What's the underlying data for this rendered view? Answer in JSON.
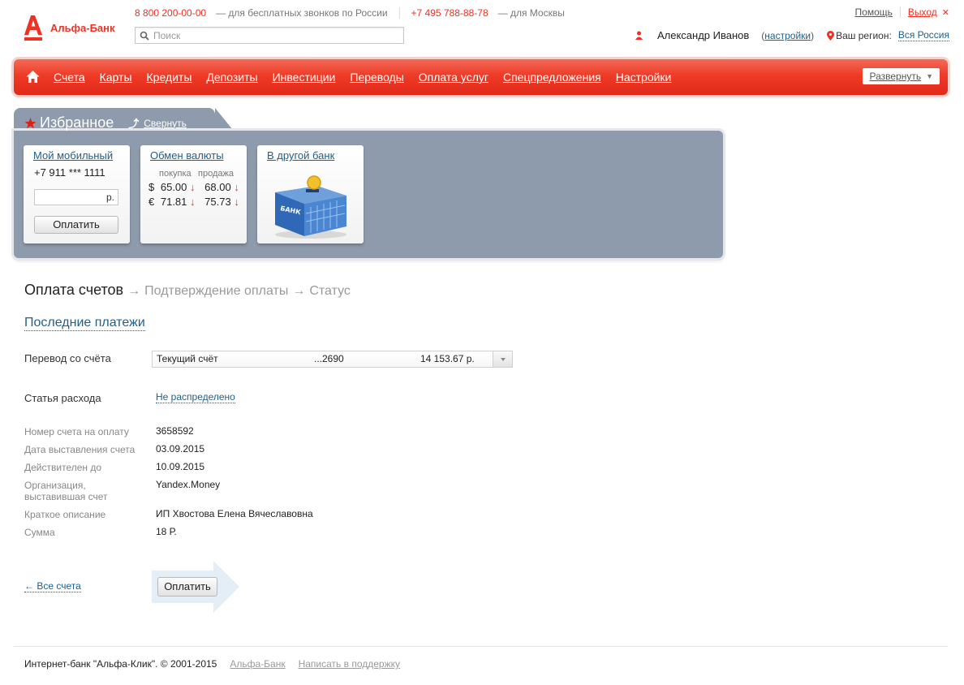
{
  "header": {
    "logo_text": "Альфа-Банк",
    "phone_free": "8 800 200-00-00",
    "phone_free_note": "— для бесплатных звонков по России",
    "phone_moscow": "+7 495 788-88-78",
    "phone_moscow_note": "— для Москвы",
    "search_placeholder": "Поиск",
    "help_label": "Помощь",
    "logout_label": "Выход",
    "user_name": "Александр Иванов",
    "settings_label": "настройки",
    "region_label": "Ваш регион:",
    "region_value": "Вся Россия"
  },
  "nav": {
    "items": [
      "Счета",
      "Карты",
      "Кредиты",
      "Депозиты",
      "Инвестиции",
      "Переводы",
      "Оплата услуг",
      "Спецпредложения",
      "Настройки"
    ],
    "expand_label": "Развернуть"
  },
  "favorites": {
    "title": "Избранное",
    "collapse_label": "Свернуть",
    "mobile": {
      "title": "Мой мобильный",
      "phone": "+7 911 *** 1111",
      "currency": "р.",
      "pay_label": "Оплатить"
    },
    "exchange": {
      "title": "Обмен валюты",
      "buy_label": "покупка",
      "sell_label": "продажа",
      "rows": [
        {
          "symbol": "$",
          "buy": "65.00",
          "sell": "68.00"
        },
        {
          "symbol": "€",
          "buy": "71.81",
          "sell": "75.73"
        }
      ],
      "trend_symbol": "↓"
    },
    "other_bank": {
      "title": "В другой банк",
      "building_sign": "БАНК"
    }
  },
  "steps": {
    "current": "Оплата счетов",
    "next": [
      "Подтверждение оплаты",
      "Статус"
    ],
    "arrow": "→"
  },
  "recent_payments": "Последние платежи",
  "transfer": {
    "label": "Перевод со счёта",
    "account_name": "Текущий счёт",
    "account_number": "...2690",
    "balance": "14 153.67 р."
  },
  "expense": {
    "label": "Статья расхода",
    "value": "Не распределено"
  },
  "details": [
    {
      "label": "Номер счета на оплату",
      "value": "3658592"
    },
    {
      "label": "Дата выставления счета",
      "value": "03.09.2015"
    },
    {
      "label": "Действителен до",
      "value": "10.09.2015"
    },
    {
      "label": "Организация,",
      "label2": "выставившая счет",
      "value": "Yandex.Money"
    },
    {
      "label": "Краткое описание",
      "value": "ИП Хвостова Елена Вячеславовна"
    },
    {
      "label": "Сумма",
      "value": "18 Р."
    }
  ],
  "actions": {
    "back_label": "← Все счета",
    "pay_label": "Оплатить"
  },
  "footer": {
    "copyright": "Интернет-банк \"Альфа-Клик\". © 2001-2015",
    "bank_link": "Альфа-Банк",
    "support_link": "Написать в поддержку"
  },
  "colors": {
    "brand_red": "#ef3124",
    "panel_gray": "#8e9bad",
    "link_blue": "#1f5f8b"
  }
}
